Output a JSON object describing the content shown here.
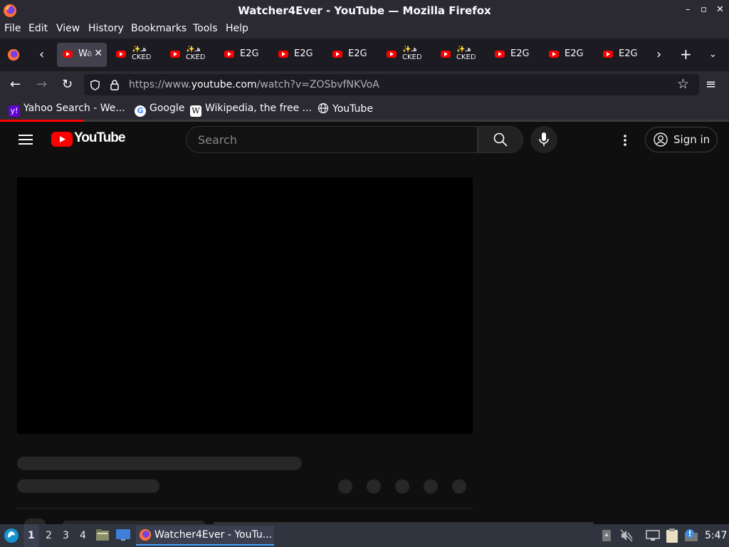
{
  "window": {
    "title": "Watcher4Ever - YouTube — Mozilla Firefox",
    "controls": [
      "–",
      "▫",
      "✕"
    ]
  },
  "menubar": {
    "items": [
      "File",
      "Edit",
      "View",
      "History",
      "Bookmarks",
      "Tools",
      "Help"
    ]
  },
  "tabs": [
    {
      "label": "Wa",
      "active": true
    },
    {
      "label_line1": "✨هـ",
      "label_line2": "CKED"
    },
    {
      "label_line1": "✨هـ",
      "label_line2": "CKED"
    },
    {
      "label": "E2G"
    },
    {
      "label": "E2G"
    },
    {
      "label": "E2G"
    },
    {
      "label_line1": "✨هـ",
      "label_line2": "CKED"
    },
    {
      "label_line1": "✨هـ",
      "label_line2": "CKED"
    },
    {
      "label": "E2G"
    },
    {
      "label": "E2G"
    },
    {
      "label": "E2G"
    }
  ],
  "navbar": {
    "url_prefix": "https://www.",
    "url_domain": "youtube.com",
    "url_path": "/watch?v=ZOSbvfNKVoA"
  },
  "bookmarks": [
    {
      "label": "Yahoo Search - We...",
      "icon": "y!"
    },
    {
      "label": "Google",
      "icon": "G"
    },
    {
      "label": "Wikipedia, the free ...",
      "icon": "W"
    },
    {
      "label": "YouTube",
      "icon": "globe-icon"
    }
  ],
  "youtube": {
    "logo_text": "YouTube",
    "search_placeholder": "Search",
    "signin_label": "Sign in",
    "loading_progress": 0.115
  },
  "taskbar": {
    "workspaces": [
      "1",
      "2",
      "3",
      "4"
    ],
    "active_workspace": "1",
    "task_label": "Watcher4Ever - YouTu...",
    "clock": "5:47"
  },
  "colors": {
    "youtube_red": "#ff0000",
    "page_bg": "#0f0f0f",
    "browser_chrome": "#2b2a33",
    "tabstrip_bg": "#1c1b22"
  }
}
